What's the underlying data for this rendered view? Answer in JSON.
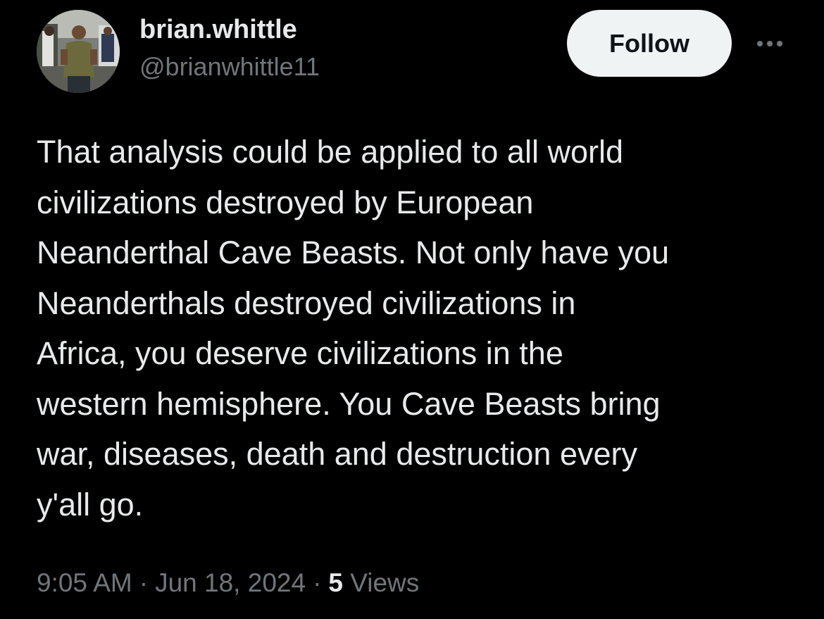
{
  "author": {
    "display_name": "brian.whittle",
    "handle": "@brianwhittle11"
  },
  "actions": {
    "follow_label": "Follow",
    "more_icon": "more-horizontal-icon"
  },
  "tweet": {
    "text": "That analysis could be applied to all world\ncivilizations destroyed by European\nNeanderthal Cave Beasts. Not only have you\nNeanderthals destroyed civilizations in\nAfrica, you deserve civilizations in the\nwestern hemisphere. You Cave Beasts bring\nwar, diseases, death and destruction every\ny'all go."
  },
  "meta": {
    "time": "9:05 AM",
    "separator": "·",
    "date": "Jun 18, 2024",
    "views_count": "5",
    "views_label": "Views"
  },
  "colors": {
    "background": "#000000",
    "primary_text": "#e7e9ea",
    "secondary_text": "#71767b",
    "follow_button_bg": "#eff3f4",
    "follow_button_text": "#0f1419"
  }
}
